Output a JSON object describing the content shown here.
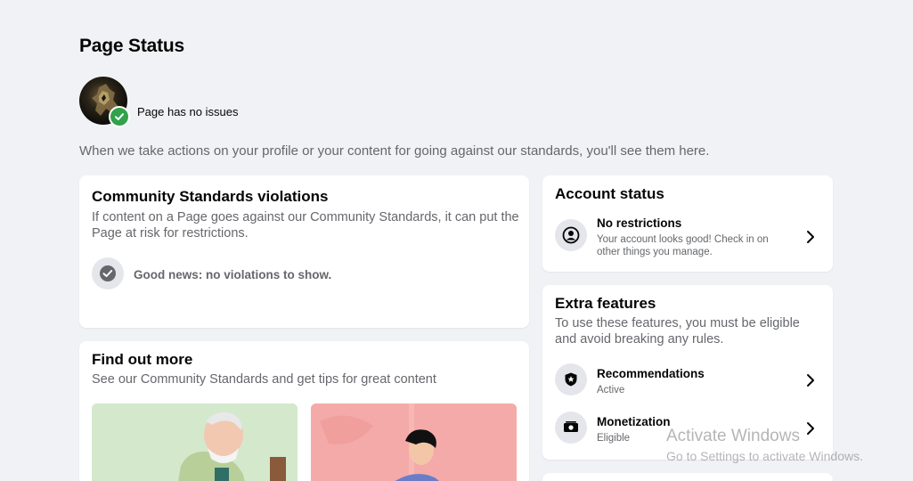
{
  "header": {
    "title": "Page Status",
    "status": "Page has no issues",
    "description": "When we take actions on your profile or your content for going against our standards, you'll see them here."
  },
  "violations": {
    "title": "Community Standards violations",
    "subtitle": "If content on a Page goes against our Community Standards, it can put the Page at risk for restrictions.",
    "good_news": "Good news: no violations to show."
  },
  "find_out_more": {
    "title": "Find out more",
    "subtitle": "See our Community Standards and get tips for great content"
  },
  "account_status": {
    "title": "Account status",
    "row_title": "No restrictions",
    "row_sub": "Your account looks good! Check in on other things you manage."
  },
  "extra_features": {
    "title": "Extra features",
    "subtitle": "To use these features, you must be eligible and avoid breaking any rules.",
    "items": [
      {
        "label": "Recommendations",
        "status": "Active",
        "icon": "shield-star-icon"
      },
      {
        "label": "Monetization",
        "status": "Eligible",
        "icon": "money-icon"
      }
    ]
  },
  "watermark": {
    "line1": "Activate Windows",
    "line2": "Go to Settings to activate Windows."
  },
  "colors": {
    "background": "#f0f2f5",
    "card": "#ffffff",
    "success": "#31a24c",
    "muted_text": "#65676b",
    "icon_bg": "#e4e6eb"
  }
}
